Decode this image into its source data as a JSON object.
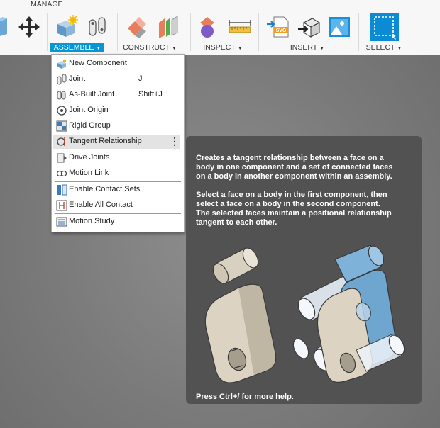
{
  "toolbar": {
    "manage_label": "MANAGE",
    "groups": [
      {
        "label": "ASSEMBLE",
        "active": true
      },
      {
        "label": "CONSTRUCT",
        "active": false
      },
      {
        "label": "INSPECT",
        "active": false
      },
      {
        "label": "INSERT",
        "active": false
      },
      {
        "label": "SELECT",
        "active": false
      }
    ],
    "icons": [
      "solid-box-icon",
      "move-icon",
      "new-component-icon",
      "joint-icon",
      "offset-plane-icon",
      "midplane-icon",
      "interference-icon",
      "measure-icon",
      "insert-svg-icon",
      "insert-mesh-icon",
      "canvas-icon",
      "select-icon"
    ]
  },
  "menu": {
    "items": [
      {
        "label": "New Component",
        "shortcut": "",
        "icon": "new-component-icon"
      },
      {
        "label": "Joint",
        "shortcut": "J",
        "icon": "joint-icon"
      },
      {
        "label": "As-Built Joint",
        "shortcut": "Shift+J",
        "icon": "as-built-joint-icon"
      },
      {
        "label": "Joint Origin",
        "shortcut": "",
        "icon": "joint-origin-icon"
      },
      {
        "label": "Rigid Group",
        "shortcut": "",
        "icon": "rigid-group-icon"
      },
      {
        "label": "Tangent Relationship",
        "shortcut": "",
        "icon": "tangent-relationship-icon",
        "more": "⋮"
      },
      {
        "label": "Drive Joints",
        "shortcut": "",
        "icon": "drive-joints-icon"
      },
      {
        "label": "Motion Link",
        "shortcut": "",
        "icon": "motion-link-icon"
      },
      {
        "label": "Enable Contact Sets",
        "shortcut": "",
        "icon": "contact-sets-icon"
      },
      {
        "label": "Enable All Contact",
        "shortcut": "",
        "icon": "all-contact-icon"
      },
      {
        "label": "Motion Study",
        "shortcut": "",
        "icon": "motion-study-icon"
      }
    ]
  },
  "tooltip": {
    "paragraph1": "Creates a tangent relationship between a face on a\nbody in one component and a set of connected faces\non a body in another component within an assembly.",
    "paragraph2": "Select a face on a body in the first component, then\nselect a face on a body in the second component.\nThe selected faces maintain a positional relationship\ntangent to each other.",
    "help": "Press Ctrl+/ for more help."
  },
  "colors": {
    "accent": "#0696d7",
    "tooltip_bg": "#525252",
    "highlight_blue": "#7fb2d8",
    "part_beige": "#dcd3c2"
  }
}
